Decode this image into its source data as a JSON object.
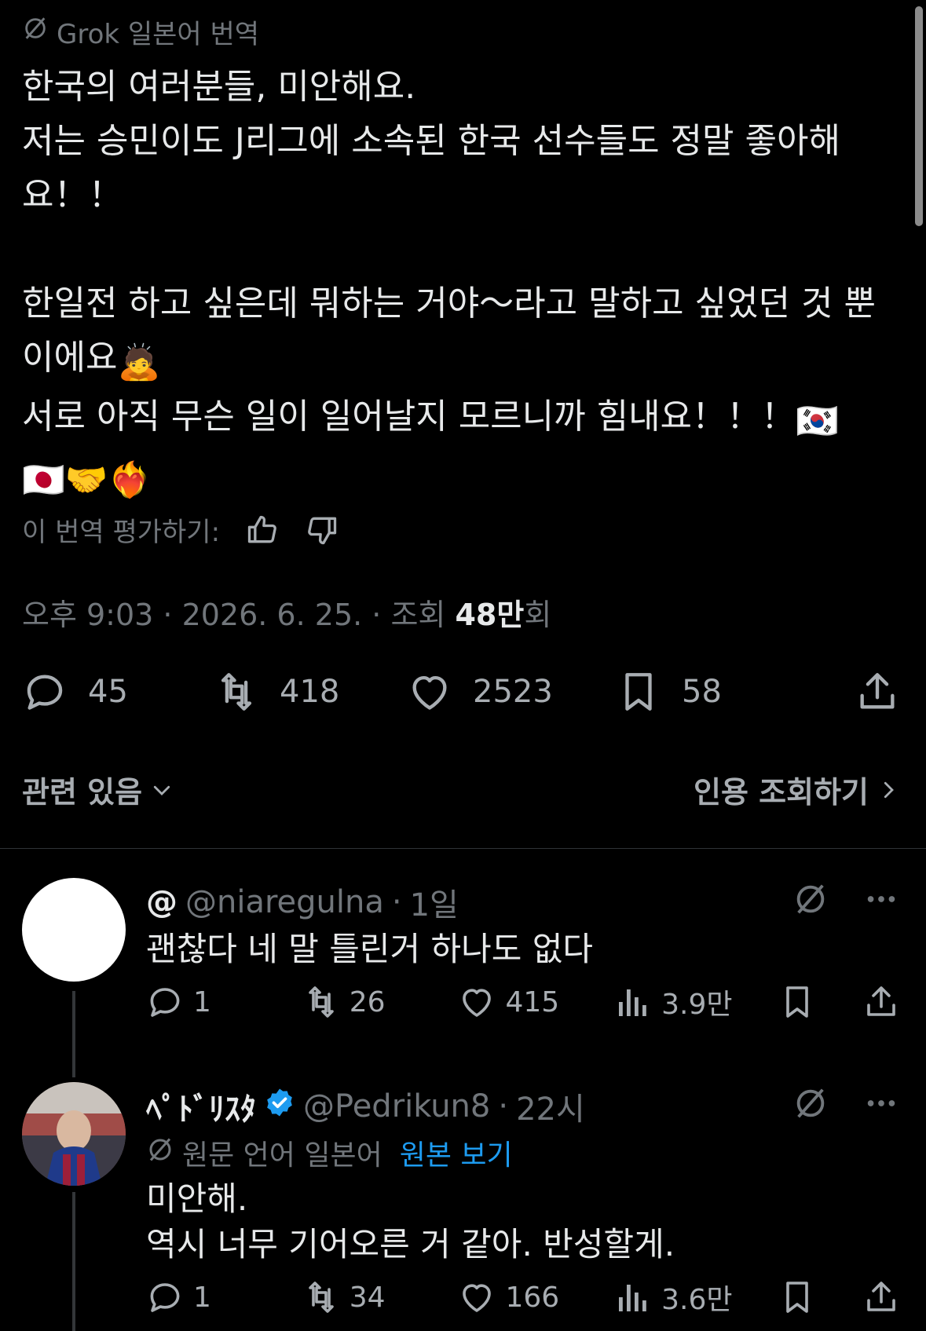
{
  "grok_label": "Grok 일본어 번역",
  "tweet": {
    "lines": [
      "한국의 여러분들, 미안해요.",
      "저는 승민이도 J리그에 소속된 한국 선수들도 정말 좋아해요！！",
      "한일전 하고 싶은데 뭐하는 거야～라고 말하고 싶었던 것 뿐이에요",
      "서로 아직 무슨 일이 일어날지 모르니까 힘내요！！！"
    ],
    "emojis": {
      "bow": "🙇",
      "kr_flag": "🇰🇷",
      "jp_flag": "🇯🇵",
      "handshake": "🤝",
      "heart_fire": "❤️‍🔥"
    },
    "rate_label": "이 번역 평가하기:",
    "time": "오후 9:03 · 2026. 6. 25. · 조회",
    "views_number": "48만",
    "views_suffix": "회",
    "stats": {
      "replies": "45",
      "retweets": "418",
      "likes": "2523",
      "bookmarks": "58"
    },
    "related_label": "관련 있음",
    "quote_label": "인용 조회하기"
  },
  "replies": [
    {
      "name": "@",
      "handle": "@niaregulna",
      "time": "1일",
      "lines": [
        "괜찮다 네 말 틀린거 하나도 없다"
      ],
      "stats": {
        "replies": "1",
        "retweets": "26",
        "likes": "415",
        "views": "3.9만"
      }
    },
    {
      "name": "ﾍﾟﾄﾞﾘｽﾀ",
      "handle": "@Pedrikun8",
      "time": "22시",
      "orig_lang": "원문 언어 일본어",
      "view_original": "원본 보기",
      "lines": [
        "미안해.",
        "역시 너무 기어오른 거 같아. 반성할게."
      ],
      "stats": {
        "replies": "1",
        "retweets": "34",
        "likes": "166",
        "views": "3.6만"
      }
    }
  ],
  "colors": {
    "background": "#000000",
    "text": "#e7e9ea",
    "muted": "#71767b",
    "link": "#1d9bf0"
  },
  "icons": [
    "grok-translate-icon",
    "thumbs-up-icon",
    "thumbs-down-icon",
    "reply-icon",
    "retweet-icon",
    "like-icon",
    "bookmark-icon",
    "share-icon",
    "chevron-down-icon",
    "chevron-right-icon",
    "more-icon",
    "views-icon",
    "verified-icon"
  ]
}
